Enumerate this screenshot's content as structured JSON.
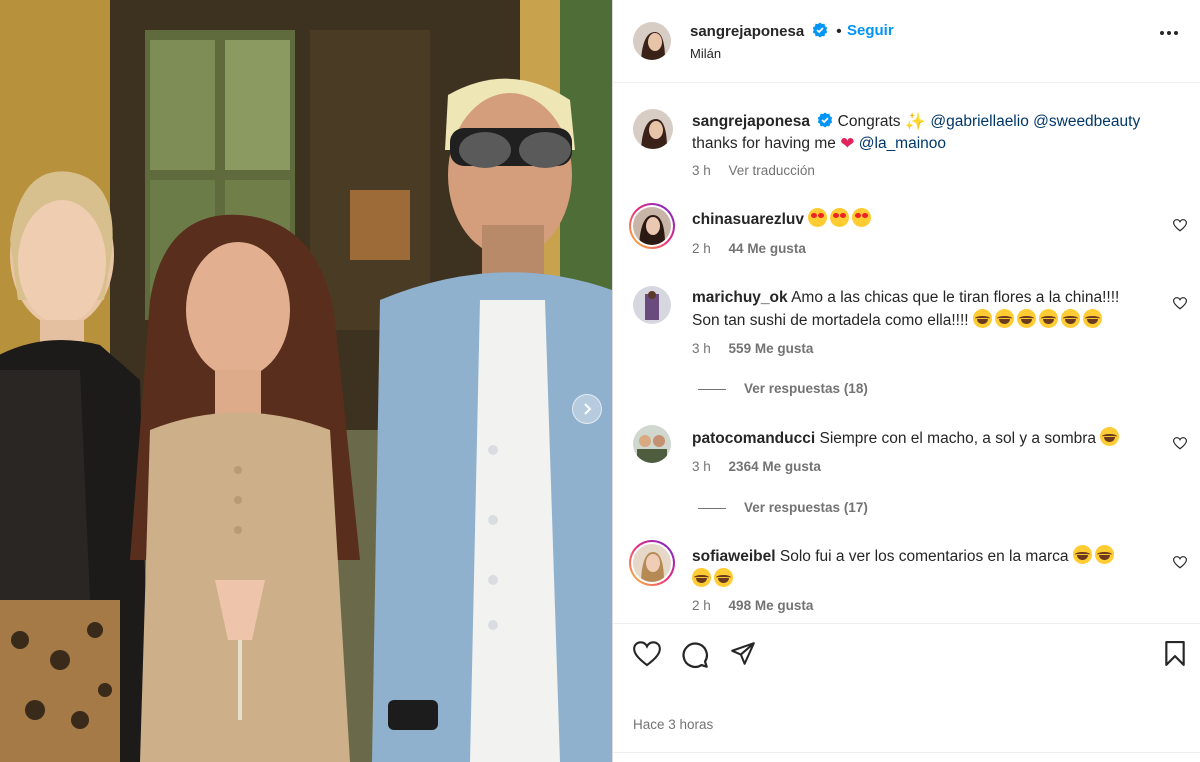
{
  "post": {
    "author": "sangrejaponesa",
    "follow_label": "Seguir",
    "location": "Milán",
    "caption": {
      "username": "sangrejaponesa",
      "text_before": "Congrats",
      "mention_1": "@gabriellaelio",
      "mention_2": "@sweedbeauty",
      "line2_text": "thanks for having me",
      "mention_3": "@la_mainoo",
      "time": "3 h",
      "translate_label": "Ver traducción"
    },
    "time_ago": "Hace 3 horas"
  },
  "comments": [
    {
      "username": "chinasuarezluv",
      "text": "",
      "time": "2 h",
      "likes": "44 Me gusta"
    },
    {
      "username": "marichuy_ok",
      "text": "Amo a las chicas que le tiran flores a la china!!!!",
      "text2": "Son tan sushi de mortadela como ella!!!!",
      "time": "3 h",
      "likes": "559 Me gusta",
      "replies": "Ver respuestas (18)"
    },
    {
      "username": "patocomanducci",
      "text": "Siempre con el macho, a sol y a sombra",
      "time": "3 h",
      "likes": "2364 Me gusta",
      "replies": "Ver respuestas (17)"
    },
    {
      "username": "sofiaweibel",
      "text": "Solo fui a ver los comentarios en la marca",
      "time": "2 h",
      "likes": "498 Me gusta"
    }
  ],
  "icons": {
    "verified": "verified-badge-icon",
    "more": "more-options-icon",
    "like": "heart-icon",
    "comment": "comment-bubble-icon",
    "share": "paper-plane-icon",
    "save": "bookmark-icon",
    "next": "chevron-right-icon"
  },
  "colors": {
    "link": "#0095f6",
    "mention": "#00376b",
    "verified": "#0095f6"
  }
}
